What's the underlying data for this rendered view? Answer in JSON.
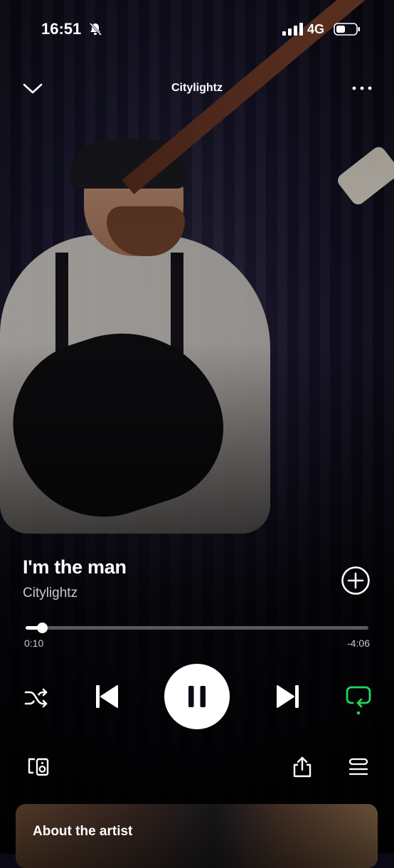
{
  "status_bar": {
    "time": "16:51",
    "network": "4G",
    "icons": [
      "bell-slash-icon",
      "signal-icon",
      "battery-icon"
    ]
  },
  "header": {
    "title": "Citylightz",
    "icons": [
      "chevron-down-icon",
      "more-icon"
    ]
  },
  "track": {
    "title": "I'm the man",
    "artist": "Citylightz",
    "add_icon": "add-circle-icon"
  },
  "progress": {
    "elapsed": "0:10",
    "remaining": "-4:06",
    "fraction": 0.047
  },
  "controls": {
    "icons": [
      "shuffle-icon",
      "previous-icon",
      "pause-icon",
      "next-icon",
      "repeat-icon"
    ],
    "repeat_active_color": "#1ed760"
  },
  "bottom_row": {
    "icons": [
      "connect-devices-icon",
      "share-icon",
      "queue-icon"
    ]
  },
  "about": {
    "label": "About the artist"
  },
  "colors": {
    "accent": "#1ed760",
    "text_secondary": "#c9c7cf",
    "background": "#0b0a14"
  }
}
